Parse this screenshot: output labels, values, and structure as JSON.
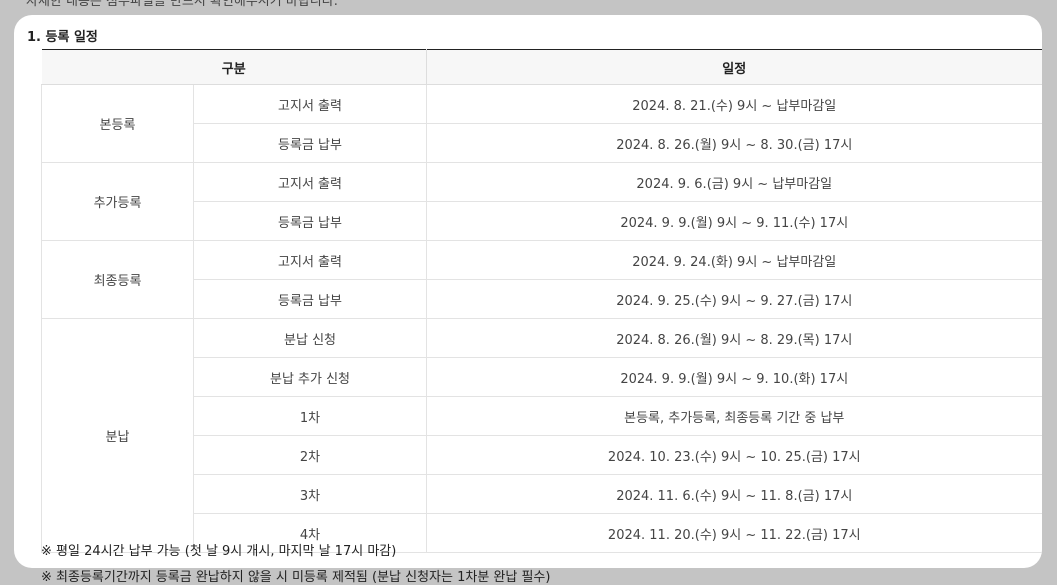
{
  "page": {
    "top_cut_text": "자세한 내용은 첨부파일을 반드시 확인해주시기 바랍니다.",
    "section_title": "1. 등록 일정"
  },
  "table": {
    "headers": {
      "category": "구분",
      "schedule": "일정"
    },
    "groups": [
      {
        "name": "본등록",
        "rows": [
          {
            "item": "고지서 출력",
            "date": "2024. 8. 21.(수) 9시 ~ 납부마감일"
          },
          {
            "item": "등록금 납부",
            "date": "2024. 8. 26.(월) 9시 ~ 8. 30.(금) 17시"
          }
        ]
      },
      {
        "name": "추가등록",
        "rows": [
          {
            "item": "고지서 출력",
            "date": "2024. 9. 6.(금) 9시 ~ 납부마감일"
          },
          {
            "item": "등록금 납부",
            "date": "2024. 9. 9.(월) 9시 ~ 9. 11.(수) 17시"
          }
        ]
      },
      {
        "name": "최종등록",
        "rows": [
          {
            "item": "고지서 출력",
            "date": "2024. 9. 24.(화) 9시 ~ 납부마감일"
          },
          {
            "item": "등록금 납부",
            "date": "2024. 9. 25.(수) 9시 ~ 9. 27.(금) 17시"
          }
        ]
      },
      {
        "name": "분납",
        "rows": [
          {
            "item": "분납 신청",
            "date": "2024. 8. 26.(월) 9시 ~ 8. 29.(목) 17시"
          },
          {
            "item": "분납 추가 신청",
            "date": "2024. 9. 9.(월) 9시 ~ 9. 10.(화) 17시"
          },
          {
            "item": "1차",
            "date": "본등록, 추가등록, 최종등록 기간 중 납부"
          },
          {
            "item": "2차",
            "date": "2024. 10. 23.(수) 9시 ~ 10. 25.(금) 17시"
          },
          {
            "item": "3차",
            "date": "2024. 11. 6.(수) 9시 ~ 11. 8.(금) 17시"
          },
          {
            "item": "4차",
            "date": "2024. 11. 20.(수) 9시 ~ 11. 22.(금) 17시"
          }
        ]
      }
    ]
  },
  "notes": [
    "※ 평일 24시간 납부 가능 (첫 날 9시 개시, 마지막 날 17시 마감)",
    "※ 최종등록기간까지 등록금 완납하지 않을 시 미등록 제적됨 (분납 신청자는 1차분 완납 필수)"
  ]
}
